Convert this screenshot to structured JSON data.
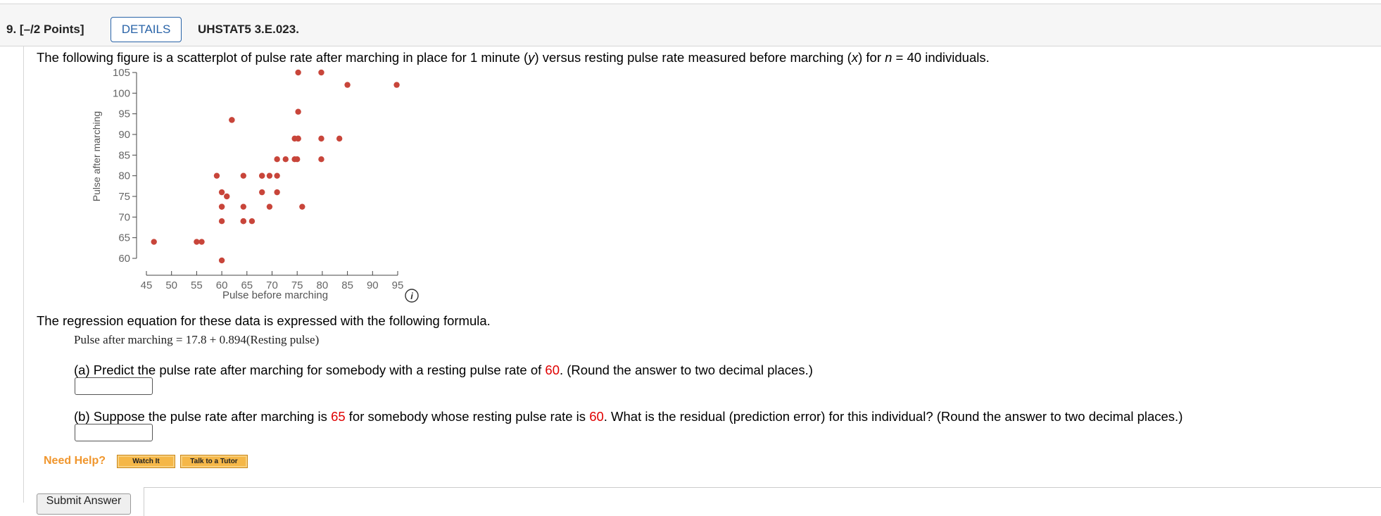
{
  "header": {
    "question_number": "9.",
    "points": "[–/2 Points]",
    "details_label": "DETAILS",
    "question_code": "UHSTAT5 3.E.023."
  },
  "intro": {
    "part1": "The following figure is a scatterplot of pulse rate after marching in place for 1 minute (",
    "y_var": "y",
    "part2": ") versus resting pulse rate measured before marching (",
    "x_var": "x",
    "part3": ") for ",
    "n_var": "n",
    "part4": " = 40 individuals."
  },
  "regression": {
    "intro": "The regression equation for these data is expressed with the following formula.",
    "formula": "Pulse after marching = 17.8 + 0.894(Resting pulse)"
  },
  "part_a": {
    "text_before": "(a) Predict the pulse rate after marching for somebody with a resting pulse rate of ",
    "value": "60",
    "text_after": ". (Round the answer to two decimal places.)",
    "answer": ""
  },
  "part_b": {
    "text1": "(b) Suppose the pulse rate after marching is ",
    "value1": "65",
    "text2": " for somebody whose resting pulse rate is ",
    "value2": "60",
    "text3": ". What is the residual (prediction error) for this individual? (Round the answer to two decimal places.)",
    "answer": ""
  },
  "help": {
    "label": "Need Help?",
    "watch_it": "Watch It",
    "talk_to_tutor": "Talk to a Tutor"
  },
  "submit_label": "Submit Answer",
  "info_icon": "info-icon",
  "colors": {
    "point": "#c8453a",
    "highlight": "#e00000",
    "details": "#2a64a8",
    "help": "#f0962d"
  },
  "chart_data": {
    "type": "scatter",
    "xlabel": "Pulse before marching",
    "ylabel": "Pulse after marching",
    "xlim": [
      45,
      95
    ],
    "ylim": [
      60,
      105
    ],
    "x_ticks": [
      45,
      50,
      55,
      60,
      65,
      70,
      75,
      80,
      85,
      90,
      95
    ],
    "y_ticks": [
      60,
      65,
      70,
      75,
      80,
      85,
      90,
      95,
      100,
      105
    ],
    "grid": false,
    "points": [
      [
        46.5,
        64
      ],
      [
        55,
        64
      ],
      [
        56,
        64
      ],
      [
        60,
        59.5
      ],
      [
        59,
        80
      ],
      [
        60,
        76
      ],
      [
        61,
        75
      ],
      [
        60,
        72.5
      ],
      [
        60,
        69
      ],
      [
        62,
        93.5
      ],
      [
        64.3,
        80
      ],
      [
        64.3,
        72.5
      ],
      [
        64.3,
        69
      ],
      [
        66,
        69
      ],
      [
        68,
        80
      ],
      [
        68,
        76
      ],
      [
        69.5,
        80
      ],
      [
        69.5,
        72.5
      ],
      [
        71,
        80
      ],
      [
        71,
        76
      ],
      [
        71,
        84
      ],
      [
        72.7,
        84
      ],
      [
        74.5,
        84
      ],
      [
        74.5,
        89
      ],
      [
        75.2,
        89
      ],
      [
        75.2,
        95.5
      ],
      [
        75.2,
        105
      ],
      [
        76,
        72.5
      ],
      [
        79.8,
        105
      ],
      [
        79.8,
        89
      ],
      [
        79.8,
        84
      ],
      [
        83.4,
        89
      ],
      [
        85,
        102
      ],
      [
        94.8,
        102
      ],
      [
        75,
        84
      ],
      [
        62,
        93.5
      ],
      [
        68,
        80
      ],
      [
        60,
        72.5
      ],
      [
        64.3,
        69
      ],
      [
        75.2,
        89
      ]
    ]
  }
}
